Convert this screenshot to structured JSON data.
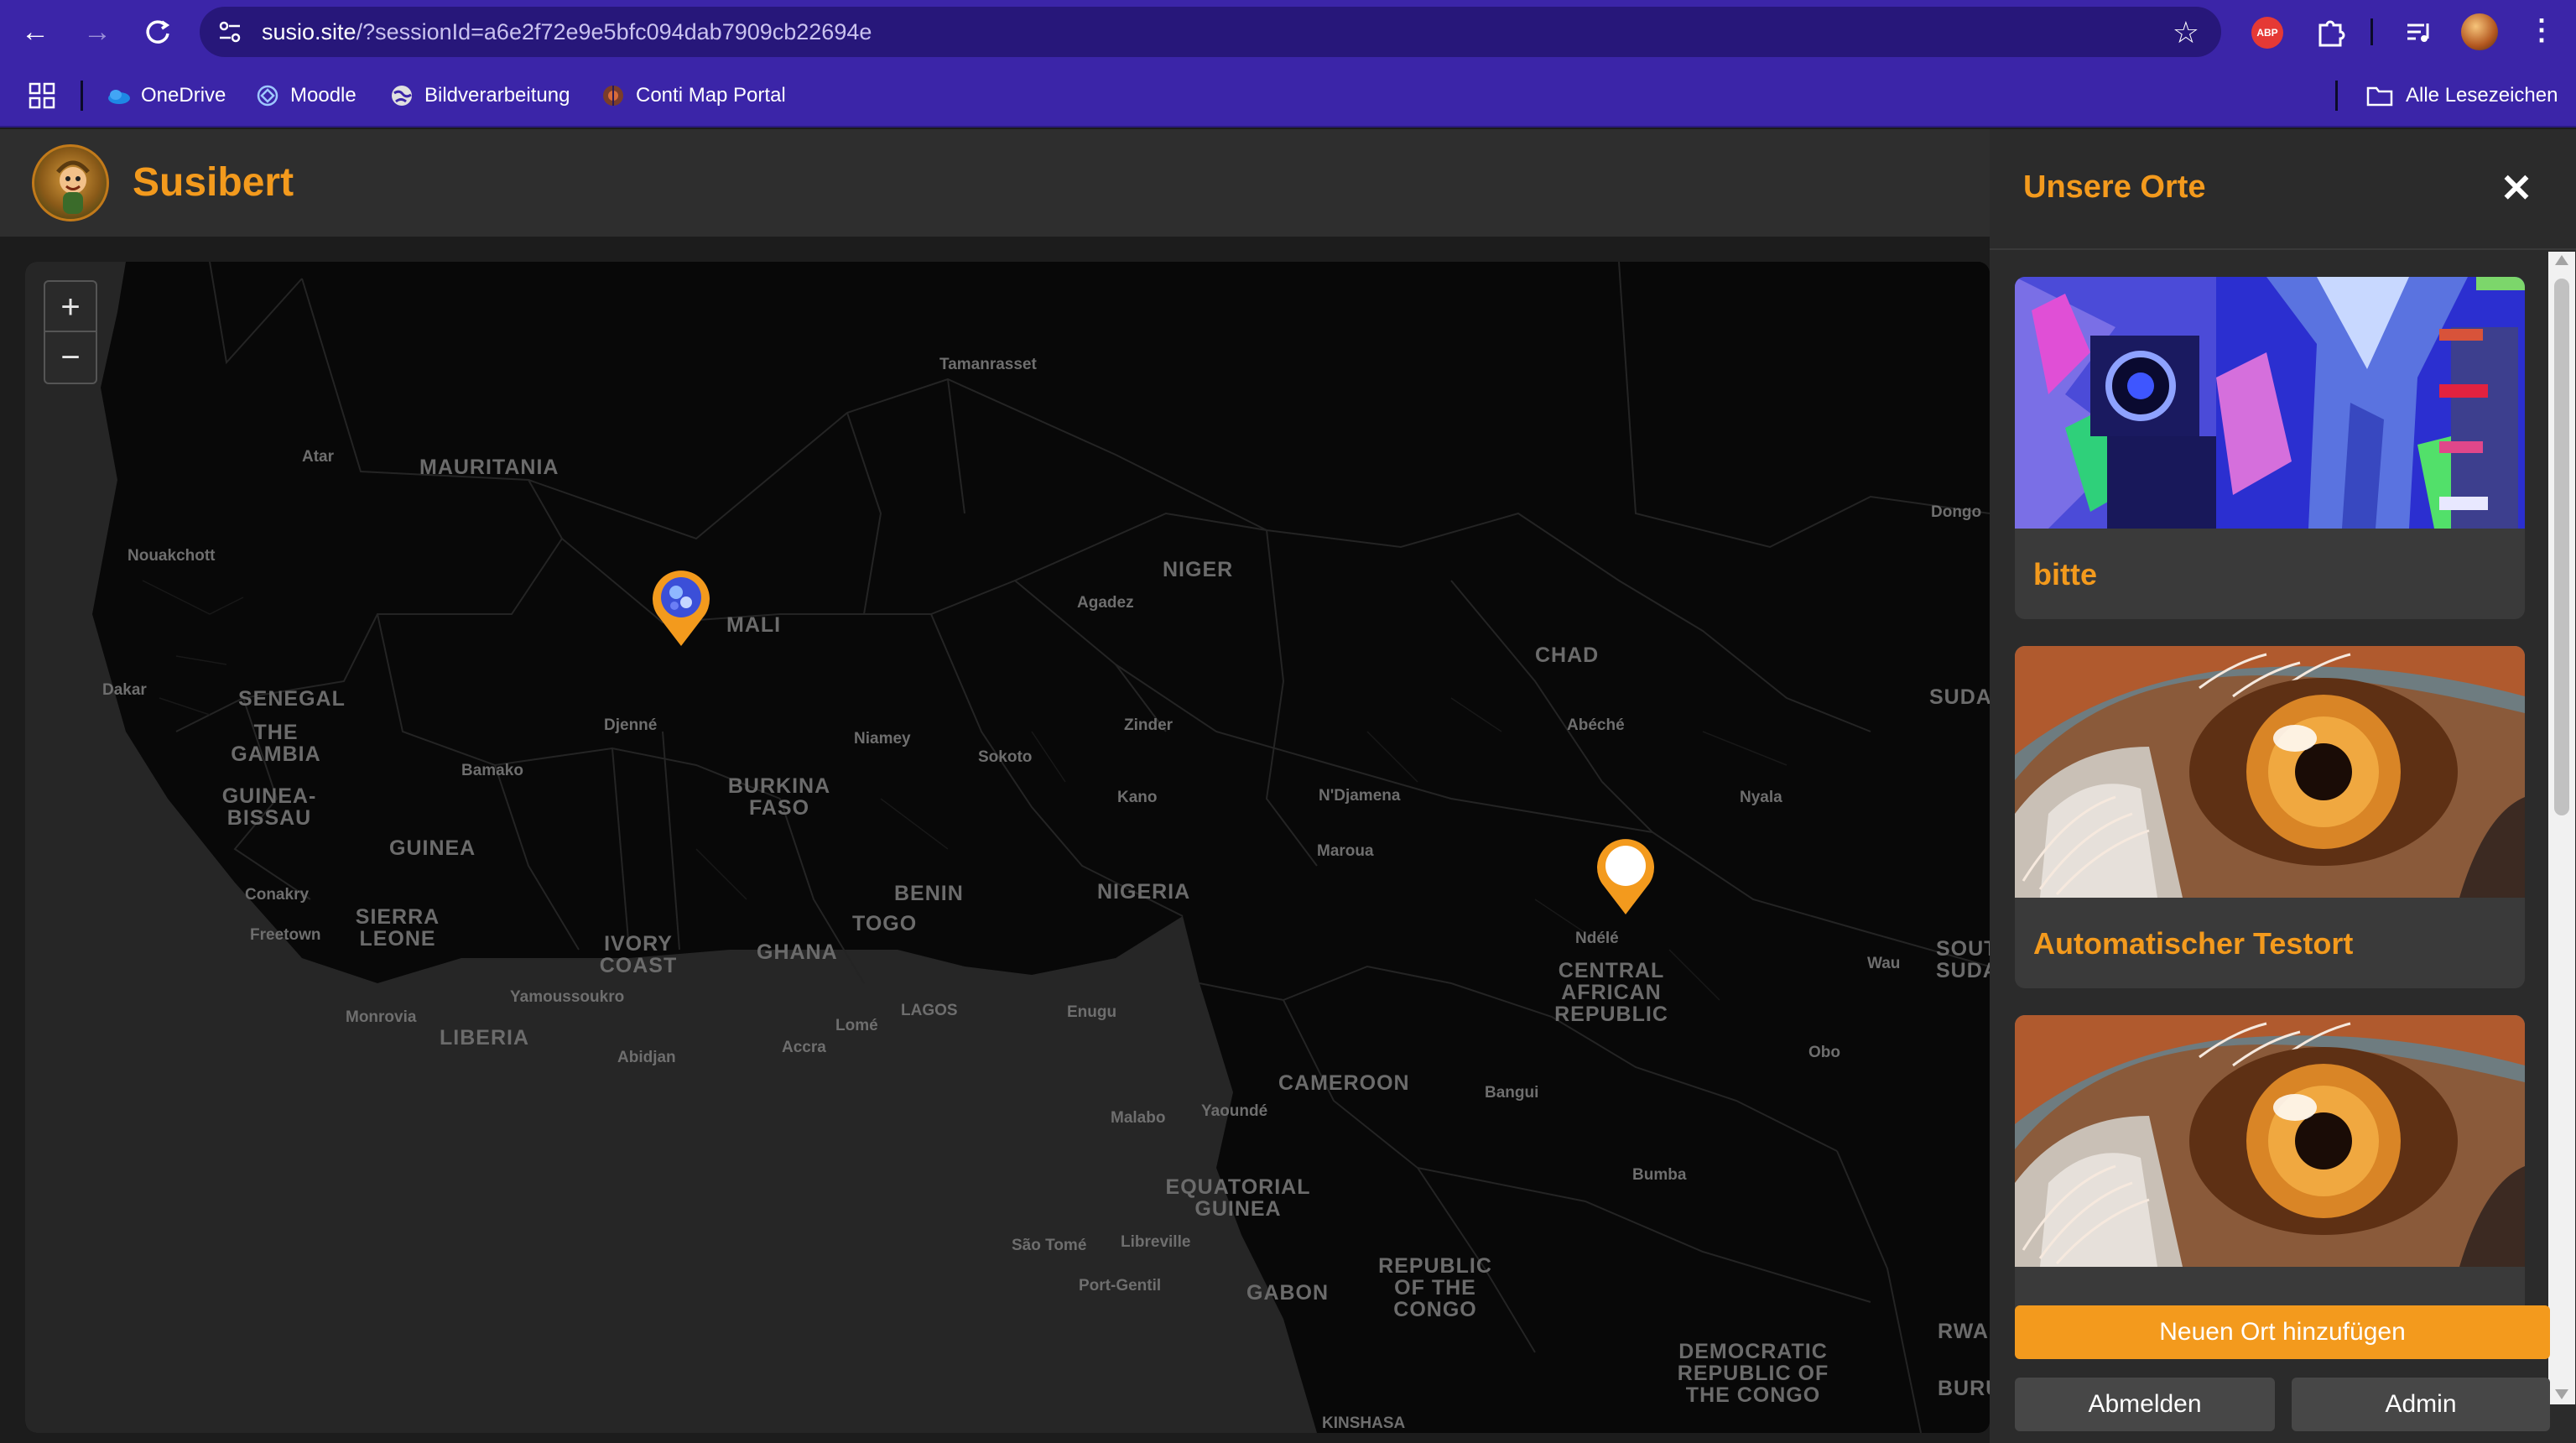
{
  "browser": {
    "url_host": "susio.site",
    "url_path": "/?sessionId=a6e2f72e9e5bfc094dab7909cb22694e",
    "extension_abp_label": "ABP",
    "bookmarks": [
      {
        "label": "OneDrive",
        "icon": "onedrive-icon"
      },
      {
        "label": "Moodle",
        "icon": "moodle-icon"
      },
      {
        "label": "Bildverarbeitung",
        "icon": "globe-icon"
      },
      {
        "label": "Conti Map Portal",
        "icon": "map-portal-icon"
      }
    ],
    "all_bookmarks_label": "Alle Lesezeichen"
  },
  "app": {
    "title": "Susibert"
  },
  "map": {
    "zoom_in": "+",
    "zoom_out": "−",
    "countries": [
      "MAURITANIA",
      "MALI",
      "NIGER",
      "CHAD",
      "SENEGAL",
      "THE GAMBIA",
      "GUINEA-BISSAU",
      "GUINEA",
      "SIERRA LEONE",
      "LIBERIA",
      "IVORY COAST",
      "BURKINA FASO",
      "GHANA",
      "TOGO",
      "BENIN",
      "NIGERIA",
      "CAMEROON",
      "CENTRAL AFRICAN REPUBLIC",
      "EQUATORIAL GUINEA",
      "GABON",
      "REPUBLIC OF THE CONGO",
      "DEMOCRATIC REPUBLIC OF THE CONGO",
      "SUDA",
      "SOUT SUDA",
      "RWA",
      "BURU"
    ],
    "cities": [
      "Tamanrasset",
      "Atar",
      "Nouakchott",
      "Dakar",
      "Agadez",
      "Djenné",
      "Niamey",
      "Zinder",
      "Sokoto",
      "Bamako",
      "Kano",
      "N'Djamena",
      "Abéché",
      "Nyala",
      "Maroua",
      "Conakry",
      "Freetown",
      "Yamoussoukro",
      "Monrovia",
      "Abidjan",
      "Accra",
      "Lomé",
      "LAGOS",
      "Enugu",
      "Ndélé",
      "Malabo",
      "Yaoundé",
      "Bangui",
      "Obo",
      "Wau",
      "Bumba",
      "São Tomé",
      "Libreville",
      "Port-Gentil",
      "KINSHASA",
      "Dongo"
    ]
  },
  "sidebar": {
    "title": "Unsere Orte",
    "close": "✕",
    "places": [
      {
        "name": "bitte",
        "image": "edited-photo-camera"
      },
      {
        "name": "Automatischer Testort",
        "image": "eagle-eye"
      },
      {
        "name": "",
        "image": "eagle-eye"
      }
    ],
    "add_button": "Neuen Ort hinzufügen",
    "logout_button": "Abmelden",
    "admin_button": "Admin"
  }
}
